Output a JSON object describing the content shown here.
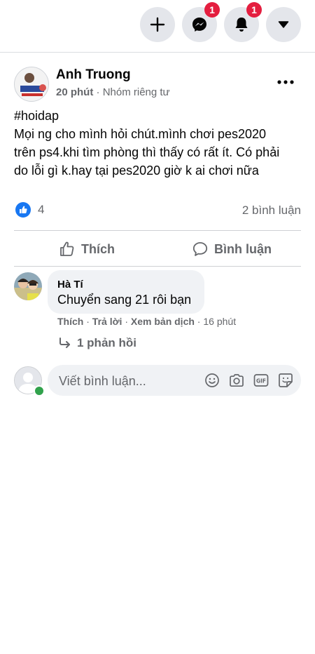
{
  "header": {
    "messenger_badge": "1",
    "notifications_badge": "1"
  },
  "post": {
    "author": "Anh Truong",
    "time": "20 phút",
    "separator": " · ",
    "audience": "Nhóm riêng tư",
    "text_lines": [
      "#hoidap",
      "Mọi ng cho mình hỏi chút.mình chơi pes2020",
      "trên ps4.khi tìm phòng thì thấy có rất ít. Có phải",
      "do lỗi gì k.hay tại pes2020 giờ k ai chơi nữa"
    ],
    "reaction_count": "4",
    "comment_count": "2 bình luận",
    "like_label": "Thích",
    "comment_label": "Bình luận"
  },
  "comment": {
    "author": "Hà Tí",
    "text": "Chuyển sang 21 rôi bạn",
    "like": "Thích",
    "reply": "Trả lời",
    "translate": "Xem bản dịch",
    "time": "16 phút",
    "dot": " · ",
    "replies_label": "1 phản hồi"
  },
  "composer": {
    "placeholder": "Viết bình luận..."
  },
  "icons": {
    "plus": "plus-icon",
    "messenger": "messenger-icon",
    "bell": "bell-icon",
    "dropdown": "caret-down-icon",
    "like_reaction": "like-reaction-icon",
    "thumb": "thumbs-up-icon",
    "speech": "comment-icon",
    "reply_arrow": "reply-arrow-icon",
    "emoji": "emoji-icon",
    "camera": "camera-icon",
    "gif": "gif-icon",
    "sticker": "sticker-icon"
  },
  "colors": {
    "badge": "#e41e3f",
    "like_blue": "#1877f2",
    "online": "#31a24c",
    "muted_text": "#65676b"
  }
}
